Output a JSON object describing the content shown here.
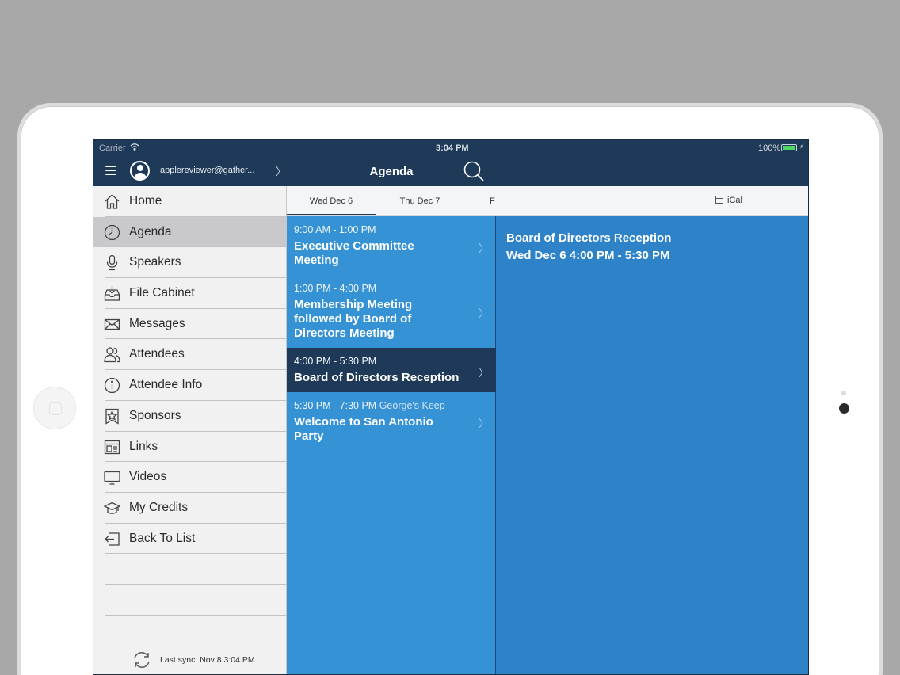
{
  "status_bar": {
    "carrier": "Carrier",
    "time": "3:04 PM",
    "battery": "100%",
    "battery_level": 1.0
  },
  "sidebar": {
    "user_email": "applereviewer@gather...",
    "items": [
      {
        "label": "Home",
        "icon": "home-icon",
        "active": false
      },
      {
        "label": "Agenda",
        "icon": "clock-icon",
        "active": true
      },
      {
        "label": "Speakers",
        "icon": "microphone-icon",
        "active": false
      },
      {
        "label": "File Cabinet",
        "icon": "file-cabinet-icon",
        "active": false
      },
      {
        "label": "Messages",
        "icon": "envelope-icon",
        "active": false
      },
      {
        "label": "Attendees",
        "icon": "people-icon",
        "active": false
      },
      {
        "label": "Attendee Info",
        "icon": "info-icon",
        "active": false
      },
      {
        "label": "Sponsors",
        "icon": "ribbon-star-icon",
        "active": false
      },
      {
        "label": "Links",
        "icon": "links-icon",
        "active": false
      },
      {
        "label": "Videos",
        "icon": "monitor-icon",
        "active": false
      },
      {
        "label": "My Credits",
        "icon": "graduation-cap-icon",
        "active": false
      },
      {
        "label": "Back To List",
        "icon": "back-arrow-icon",
        "active": false
      }
    ],
    "sync_text": "Last sync:  Nov 8 3:04 PM"
  },
  "agenda": {
    "title": "Agenda",
    "tabs": [
      {
        "label": "Wed  Dec 6",
        "active": true
      },
      {
        "label": "Thu  Dec 7",
        "active": false
      },
      {
        "label": "F",
        "active": false
      }
    ],
    "sessions": [
      {
        "time": "9:00 AM - 1:00 PM",
        "location": "",
        "title_lines": [
          "Executive Committee",
          "Meeting"
        ],
        "selected": false
      },
      {
        "time": "1:00 PM - 4:00 PM",
        "location": "",
        "title_lines": [
          "Membership Meeting",
          "followed by Board of",
          "Directors Meeting"
        ],
        "selected": false
      },
      {
        "time": "4:00 PM - 5:30 PM",
        "location": "",
        "title_lines": [
          "Board of Directors Reception"
        ],
        "selected": true
      },
      {
        "time": "5:30 PM - 7:30 PM",
        "location": "George's Keep",
        "title_lines": [
          "Welcome to San Antonio",
          "Party"
        ],
        "selected": false
      }
    ]
  },
  "detail": {
    "ical_label": "iCal",
    "title": "Board of Directors Reception",
    "when": "Wed  Dec 6 4:00 PM - 5:30 PM"
  },
  "colors": {
    "header": "#1e3a58",
    "agenda_bg": "#3592d4",
    "detail_bg": "#2e83c8",
    "sidebar_bg": "#f1f1f2",
    "selected_row": "#1e3a58"
  }
}
